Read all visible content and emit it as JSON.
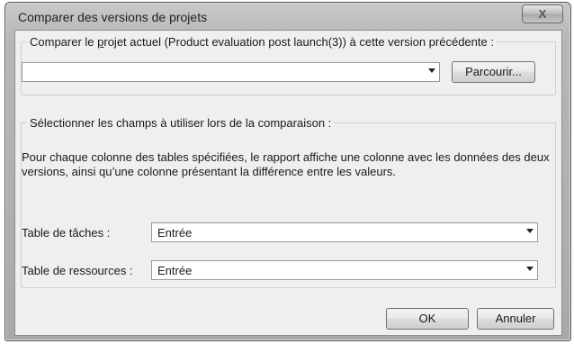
{
  "window": {
    "title": "Comparer des versions de projets",
    "close_glyph": "X"
  },
  "previous_version": {
    "legend_prefix": "Comparer le ",
    "legend_accel": "p",
    "legend_suffix": "rojet actuel (Product evaluation post launch(3)) à cette version précédente :",
    "combo_value": "",
    "browse_label": "Parcourir..."
  },
  "fields": {
    "legend": "Sélectionner les champs à utiliser lors de la comparaison :",
    "description": "Pour chaque colonne des tables spécifiées, le rapport affiche une colonne avec les données des deux versions, ainsi qu’une colonne présentant la différence entre les valeurs.",
    "task_table_label": "Table de tâches :",
    "task_table_value": "Entrée",
    "resource_table_label": "Table de ressources :",
    "resource_table_value": "Entrée"
  },
  "footer": {
    "ok_label": "OK",
    "cancel_label": "Annuler"
  }
}
